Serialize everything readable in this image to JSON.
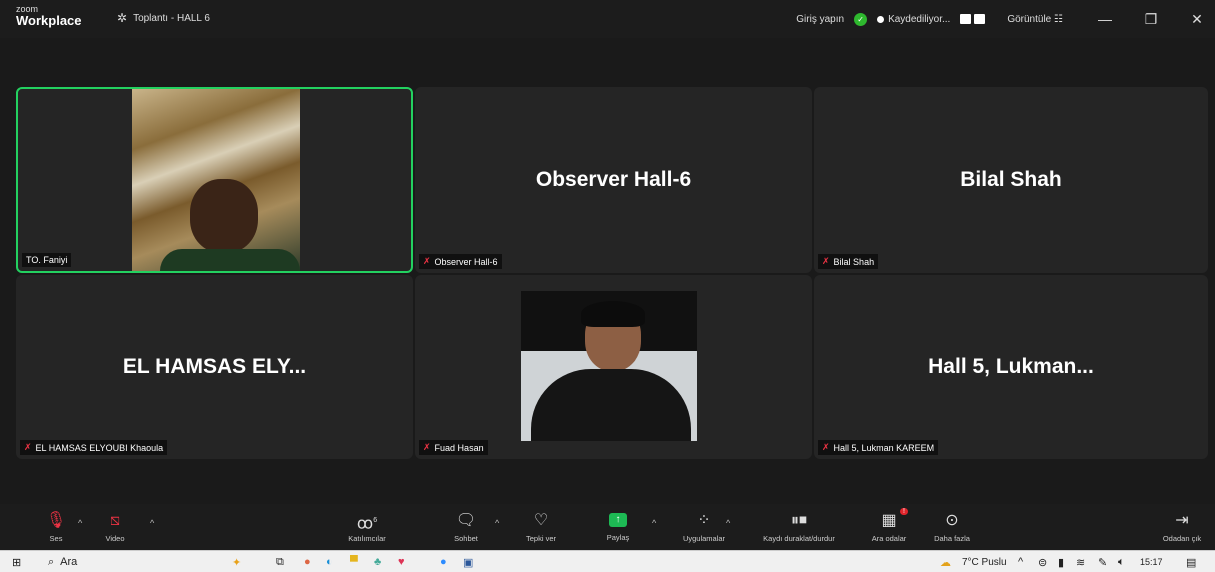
{
  "titlebar": {
    "logo_small": "zoom",
    "logo_big": "Workplace",
    "meeting_title": "Toplantı - HALL 6",
    "sign_in": "Giriş yapın",
    "recording": "Kaydediliyor...",
    "view": "Görüntüle",
    "minimize": "—",
    "restore": "❐",
    "close": "✕"
  },
  "tiles": [
    {
      "display_name": "",
      "label": "TO. Faniyi",
      "muted": false
    },
    {
      "display_name": "Observer Hall-6",
      "label": "Observer Hall-6",
      "muted": true
    },
    {
      "display_name": "Bilal Shah",
      "label": "Bilal Shah",
      "muted": true
    },
    {
      "display_name": "EL HAMSAS ELY...",
      "label": "EL HAMSAS ELYOUBI Khaoula",
      "muted": true
    },
    {
      "display_name": "",
      "label": "Fuad Hasan",
      "muted": true
    },
    {
      "display_name": "Hall 5, Lukman...",
      "label": "Hall 5, Lukman KAREEM",
      "muted": true
    }
  ],
  "toolbar": {
    "audio": "Ses",
    "video": "Video",
    "participants": "Katılımcılar",
    "participants_count": "6",
    "chat": "Sohbet",
    "react": "Tepki ver",
    "share": "Paylaş",
    "apps": "Uygulamalar",
    "record": "Kaydı duraklat/durdur",
    "breakout": "Ara odalar",
    "more": "Daha fazla",
    "leave": "Odadan çık"
  },
  "taskbar": {
    "search": "Ara",
    "weather": "7°C Puslu",
    "time": "15:17"
  },
  "colors": {
    "active_border": "#23d160",
    "muted_red": "#e33344",
    "share_green": "#1db954"
  }
}
